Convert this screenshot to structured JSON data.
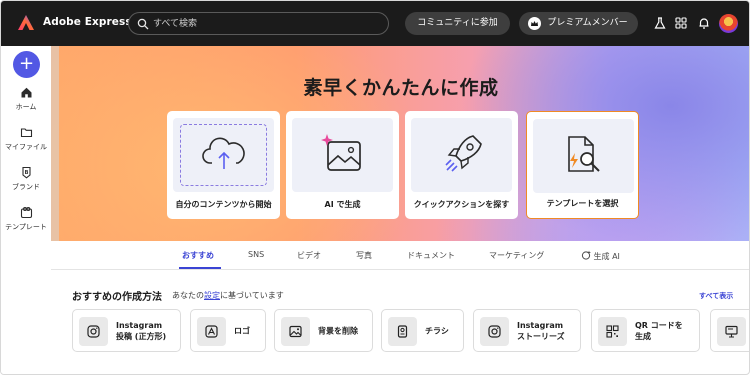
{
  "app": {
    "title": "Adobe Express"
  },
  "header": {
    "search_placeholder": "すべて検索",
    "community_label": "コミュニティに参加",
    "premium_label": "プレミアムメンバー"
  },
  "sidebar": {
    "items": [
      {
        "label": "ホーム",
        "icon": "home-icon"
      },
      {
        "label": "マイファイル",
        "icon": "folder-icon"
      },
      {
        "label": "ブランド",
        "icon": "brand-icon"
      },
      {
        "label": "テンプレート",
        "icon": "template-icon"
      }
    ]
  },
  "hero": {
    "title": "素早くかんたんに作成",
    "cards": [
      {
        "label": "自分のコンテンツから開始"
      },
      {
        "label": "AI で生成"
      },
      {
        "label": "クイックアクションを探す"
      },
      {
        "label": "テンプレートを選択"
      }
    ]
  },
  "tabs": [
    {
      "label": "おすすめ",
      "active": true
    },
    {
      "label": "SNS"
    },
    {
      "label": "ビデオ"
    },
    {
      "label": "写真"
    },
    {
      "label": "ドキュメント"
    },
    {
      "label": "マーケティング"
    },
    {
      "label": "生成 AI"
    }
  ],
  "recommendations": {
    "title": "おすすめの作成方法",
    "subtitle_prefix": "あなたの",
    "subtitle_link": "設定",
    "subtitle_suffix": "に基づいています",
    "show_all": "すべて表示",
    "actions": [
      {
        "label": "Instagram\n投稿 (正方形)",
        "icon": "instagram-icon"
      },
      {
        "label": "ロゴ",
        "icon": "logo-icon"
      },
      {
        "label": "背景を削除",
        "icon": "remove-background-icon"
      },
      {
        "label": "チラシ",
        "icon": "flyer-icon"
      },
      {
        "label": "Instagram\nストーリーズ",
        "icon": "instagram-icon"
      },
      {
        "label": "QR コードを\n生成",
        "icon": "qr-code-icon"
      },
      {
        "label": "",
        "icon": "presentation-icon"
      }
    ]
  },
  "colors": {
    "accent": "#3b44d4",
    "plus_button": "#5258e4",
    "topbar": "#1b1b1b"
  }
}
